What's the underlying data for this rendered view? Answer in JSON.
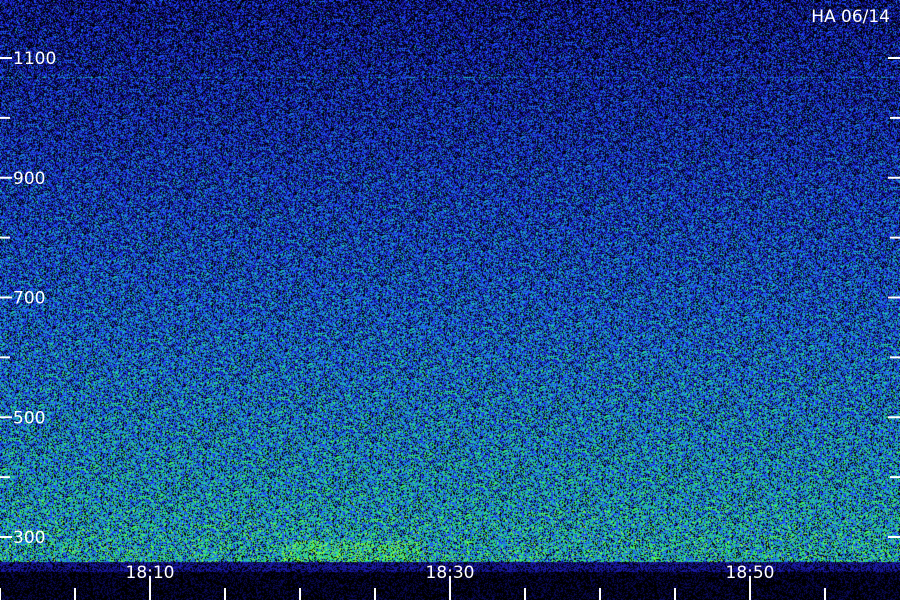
{
  "station_label": "HA 06/14",
  "chart_data": {
    "type": "heatmap",
    "title": "",
    "xlabel": "",
    "ylabel": "",
    "y_tick_labels": [
      "1100",
      "900",
      "700",
      "500",
      "300"
    ],
    "y_tick_values": [
      1100,
      900,
      700,
      500,
      300
    ],
    "y_minor_values": [
      1200,
      1000,
      800,
      600,
      400
    ],
    "ylim": [
      230,
      1200
    ],
    "x_tick_labels": [
      "18:10",
      "18:30",
      "18:50"
    ],
    "x_tick_values": [
      10,
      30,
      50
    ],
    "x_minor_values": [
      0,
      5,
      15,
      20,
      25,
      35,
      40,
      45,
      55
    ],
    "xlim": [
      0,
      57
    ],
    "colormap": [
      "#000000",
      "#0a0a5a",
      "#1a1aa8",
      "#1e3cff",
      "#1e82d2",
      "#1ec8b4",
      "#3cf05a",
      "#96ff3c"
    ],
    "grid": false
  }
}
